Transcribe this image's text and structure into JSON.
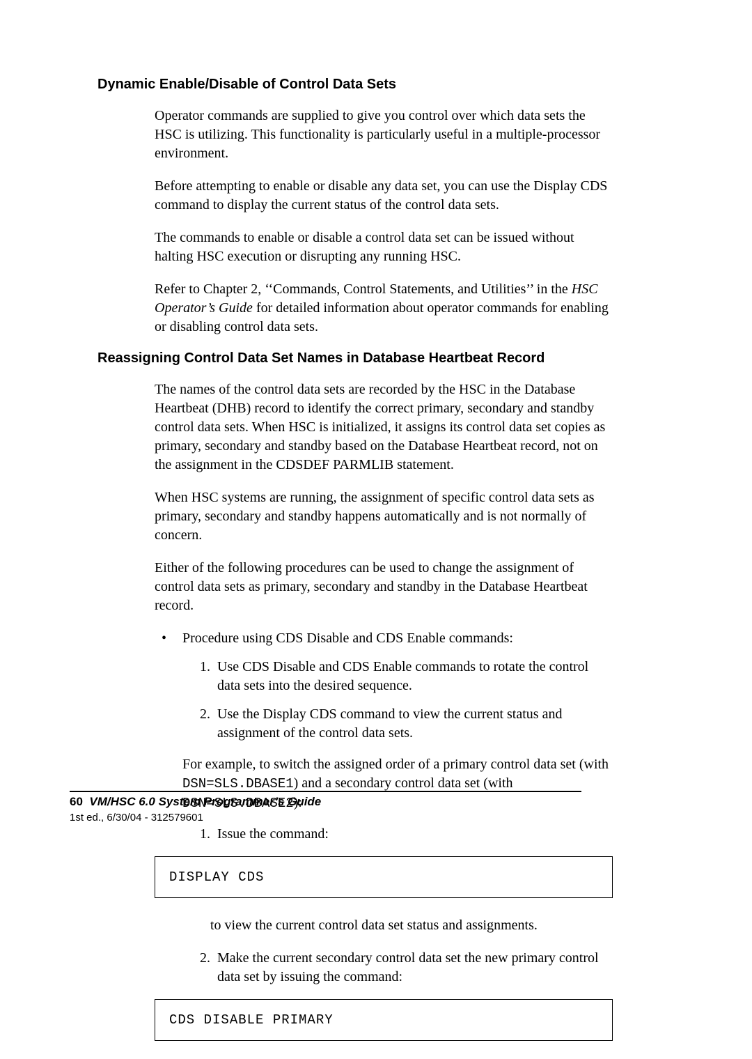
{
  "section1": {
    "heading": "Dynamic Enable/Disable of Control Data Sets",
    "p1": "Operator commands are supplied to give you control over which data sets the HSC is utilizing. This functionality is particularly useful in a multiple-processor environment.",
    "p2": "Before attempting to enable or disable any data set, you can use the Display CDS command to display the current status of the control data sets.",
    "p3": "The commands to enable or disable a control data set can be issued without halting HSC execution or disrupting any running HSC.",
    "p4_pre": "Refer to Chapter 2, ‘‘Commands, Control Statements, and Utilities’’ in the ",
    "p4_italic": "HSC Operator’s Guide",
    "p4_post": " for detailed information about operator commands for enabling or disabling control data sets."
  },
  "section2": {
    "heading": "Reassigning Control Data Set Names in Database Heartbeat Record",
    "p1": "The names of the control data sets are recorded by the HSC in the Database Heartbeat (DHB) record to identify the correct primary, secondary and standby control data sets. When HSC is initialized, it assigns its control data set copies as primary, secondary and standby based on the Database Heartbeat record, not on the assignment in the CDSDEF PARMLIB statement.",
    "p2": "When HSC systems are running, the assignment of specific control data sets as primary, secondary and standby happens automatically and is not normally of concern.",
    "p3": "Either of the following procedures can be used to change the assignment of control data sets as primary, secondary and standby in the Database Heartbeat record.",
    "bullet1": "Procedure using CDS Disable and CDS Enable commands:",
    "step1": "Use CDS Disable and CDS Enable commands to rotate the control data sets into the desired sequence.",
    "step2": "Use the Display CDS command to view the current status and assignment of the control data sets.",
    "example_pre": "For example, to switch the assigned order of a primary control data set (with ",
    "example_code1": "DSN=SLS.DBASE1",
    "example_mid": ") and a secondary control data set (with ",
    "example_code2": "DSN=SLS.DBASE2",
    "example_post": "):",
    "sub1_marker": "1.",
    "sub1_text": "Issue the command:",
    "codebox1": "DISPLAY CDS",
    "sub1_after": "to view the current control data set status and assignments.",
    "sub2_marker": "2.",
    "sub2_text": "Make the current secondary control data set the new primary control data set by issuing the command:",
    "codebox2": "CDS DISABLE PRIMARY",
    "list_marker_1": "1.",
    "list_marker_2": "2.",
    "bullet_marker": "•"
  },
  "footer": {
    "page_number": "60",
    "title": "VM/HSC 6.0 System Programmer’s Guide",
    "edition": "1st ed., 6/30/04 - 312579601"
  }
}
